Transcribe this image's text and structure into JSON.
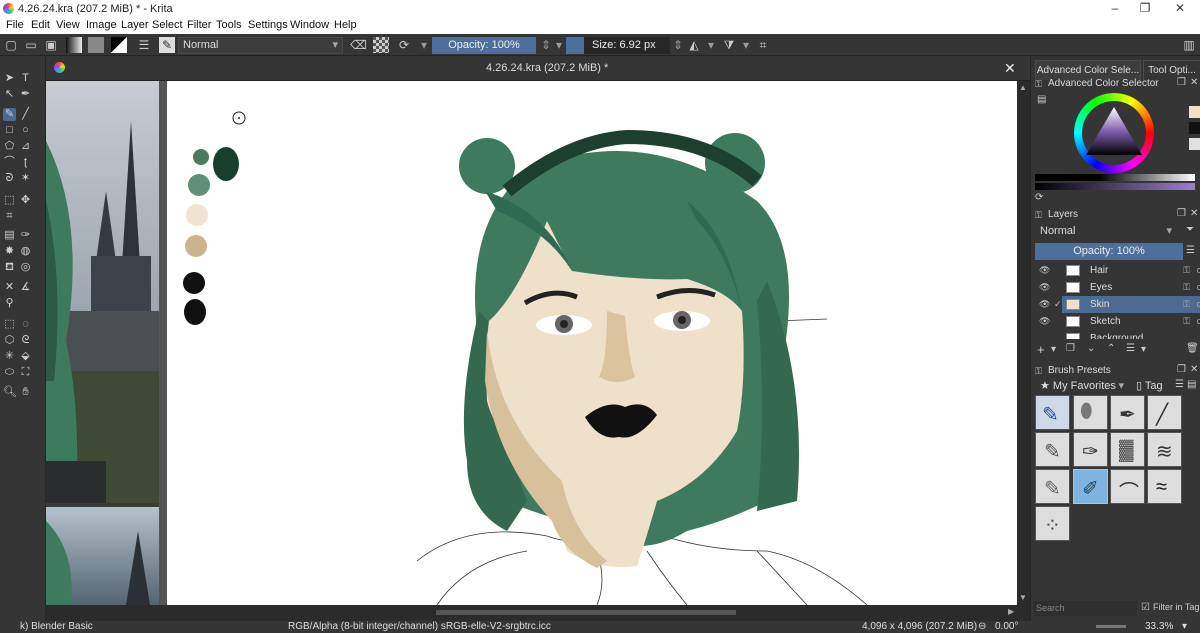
{
  "window": {
    "title": "4.26.24.kra (207.2 MiB) * - Krita",
    "minimize": "–",
    "maximize": "❐",
    "close": "✕"
  },
  "menu": [
    "File",
    "Edit",
    "View",
    "Image",
    "Layer",
    "Select",
    "Filter",
    "Tools",
    "Settings",
    "Window",
    "Help"
  ],
  "toolbar": {
    "blend_mode": "Normal",
    "opacity_label": "Opacity: 100%",
    "opacity_value": 100,
    "size_label": "Size: 6.92 px"
  },
  "document": {
    "tab_title": "4.26.24.kra (207.2 MiB) *",
    "close": "✕"
  },
  "dock": {
    "tabs": [
      "Advanced Color Sele...",
      "Tool Opti..."
    ],
    "color_selector": {
      "title": "Advanced Color Selector"
    },
    "layers": {
      "title": "Layers",
      "blend_mode": "Normal",
      "opacity_label": "Opacity:  100%",
      "items": [
        {
          "name": "Hair",
          "selected": false
        },
        {
          "name": "Eyes",
          "selected": false
        },
        {
          "name": "Skin",
          "selected": true
        },
        {
          "name": "Sketch",
          "selected": false
        },
        {
          "name": "Background",
          "selected": false
        }
      ]
    },
    "brushes": {
      "title": "Brush Presets",
      "tag": "My Favorites",
      "tag_button": "Tag",
      "search_placeholder": "Search",
      "filter_label": "Filter in Tag"
    }
  },
  "status": {
    "brush": "k) Blender Basic",
    "color_space": "RGB/Alpha (8-bit integer/channel)  sRGB-elle-V2-srgbtrc.icc",
    "size": "4,096 x 4,096 (207.2 MiB)",
    "rotation": "0.00°",
    "zoom": "33.3%"
  },
  "colors": {
    "accent": "#4b6b93",
    "hair": "#3e7a5e",
    "skin": "#eee0c9",
    "panel": "#353535"
  }
}
